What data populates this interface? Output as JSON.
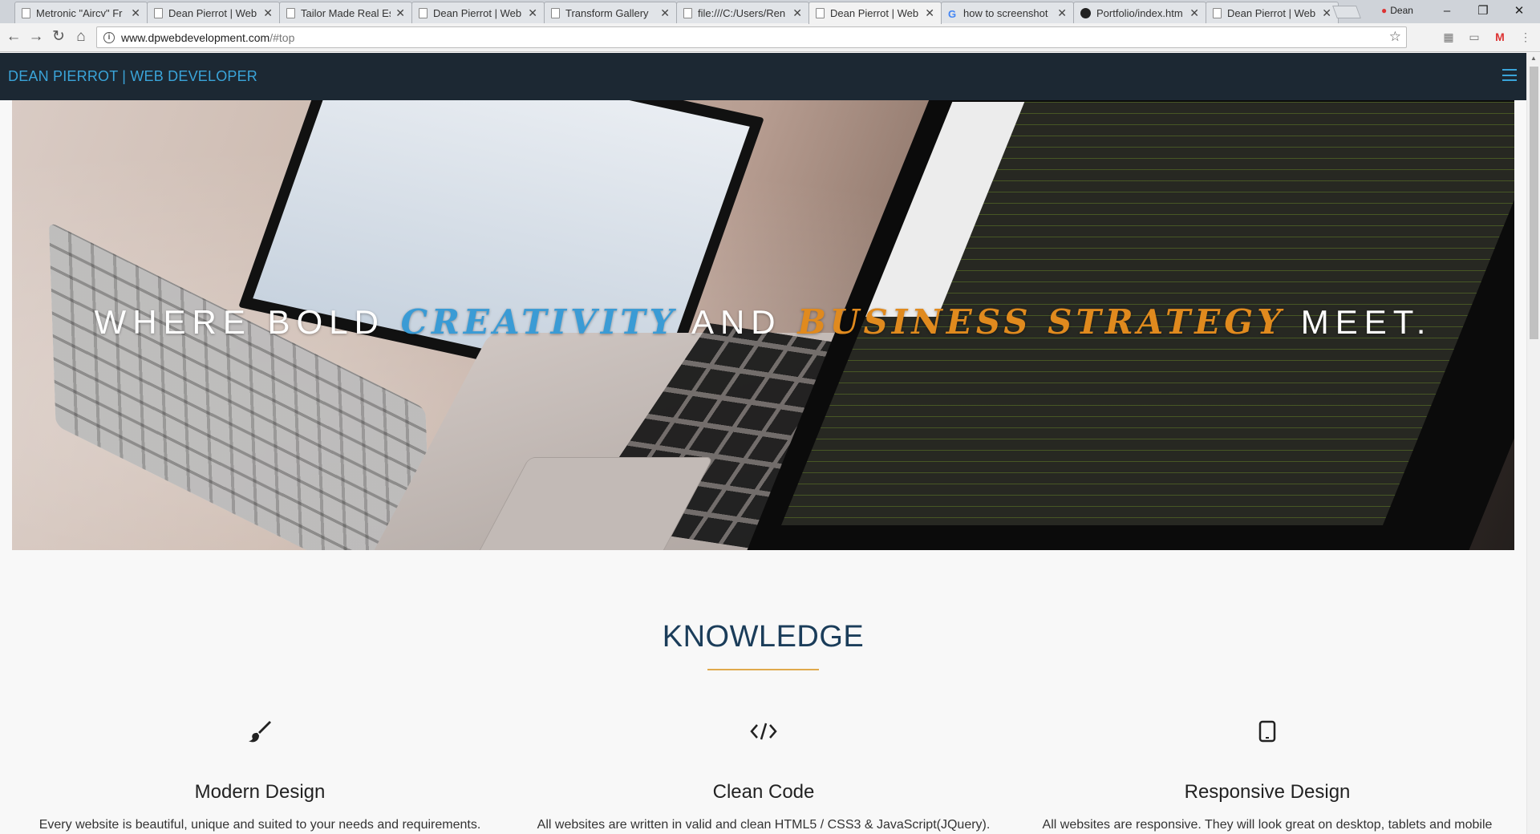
{
  "browser": {
    "tabs": [
      {
        "title": "Metronic \"Aircv\" Fr",
        "icon": "page-icon",
        "active": false
      },
      {
        "title": "Dean Pierrot | Web",
        "icon": "page-icon",
        "active": false
      },
      {
        "title": "Tailor Made Real Es",
        "icon": "page-icon",
        "active": false
      },
      {
        "title": "Dean Pierrot | Web",
        "icon": "page-icon",
        "active": false
      },
      {
        "title": "Transform Gallery",
        "icon": "page-icon",
        "active": false
      },
      {
        "title": "file:///C:/Users/Ren",
        "icon": "page-icon",
        "active": false
      },
      {
        "title": "Dean Pierrot | Web",
        "icon": "page-icon",
        "active": true
      },
      {
        "title": "how to screenshot",
        "icon": "google-icon",
        "active": false
      },
      {
        "title": "Portfolio/index.htm",
        "icon": "github-icon",
        "active": false
      },
      {
        "title": "Dean Pierrot | Web",
        "icon": "page-icon",
        "active": false
      }
    ],
    "profile_name": "Dean",
    "url_host": "www.dpwebdevelopment.com",
    "url_path": "/#top"
  },
  "site": {
    "brand": "DEAN PIERROT | WEB DEVELOPER",
    "hero": {
      "part1": "WHERE BOLD ",
      "highlight1": "CREATIVITY",
      "part2": " AND ",
      "highlight2": "BUSINESS STRATEGY",
      "part3": " MEET.",
      "highlight1_color": "#3a9bd5",
      "highlight2_color": "#e08a1e"
    },
    "knowledge": {
      "title": "KNOWLEDGE",
      "items": [
        {
          "icon": "paintbrush-icon",
          "heading": "Modern Design",
          "text": "Every website is beautiful, unique and suited to your needs and requirements."
        },
        {
          "icon": "code-icon",
          "heading": "Clean Code",
          "text": "All websites are written in valid and clean HTML5 / CSS3 & JavaScript(JQuery)."
        },
        {
          "icon": "tablet-icon",
          "heading": "Responsive Design",
          "text": "All websites are responsive. They will look great on desktop, tablets and mobile"
        }
      ]
    },
    "colors": {
      "nav_bg": "#1c2833",
      "brand": "#3aa4d9",
      "accent": "#e0a94c",
      "title": "#1b3d5a"
    }
  }
}
